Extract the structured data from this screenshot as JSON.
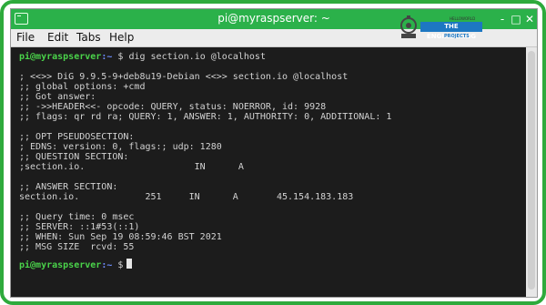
{
  "window": {
    "title": "pi@myraspserver: ~",
    "controls": {
      "minimize": "-",
      "maximize": "□",
      "close": "✕"
    }
  },
  "menu": {
    "items": [
      "File",
      "Edit",
      "Tabs",
      "Help"
    ]
  },
  "logo": {
    "tagline": "HELLOWORLD",
    "name": "THE ENGINEERING",
    "sub": "PROJECTS"
  },
  "prompt": {
    "user": "pi@myraspserver",
    "path": ":~",
    "symbol": "$"
  },
  "command": "dig section.io @localhost",
  "output": [
    "; <<>> DiG 9.9.5-9+deb8u19-Debian <<>> section.io @localhost",
    ";; global options: +cmd",
    ";; Got answer:",
    ";; ->>HEADER<<- opcode: QUERY, status: NOERROR, id: 9928",
    ";; flags: qr rd ra; QUERY: 1, ANSWER: 1, AUTHORITY: 0, ADDITIONAL: 1",
    "",
    ";; OPT PSEUDOSECTION:",
    "; EDNS: version: 0, flags:; udp: 1280",
    ";; QUESTION SECTION:",
    ";section.io.                    IN      A",
    "",
    ";; ANSWER SECTION:",
    "section.io.            251     IN      A       45.154.183.183",
    "",
    ";; Query time: 0 msec",
    ";; SERVER: ::1#53(::1)",
    ";; WHEN: Sun Sep 19 08:59:46 BST 2021",
    ";; MSG SIZE  rcvd: 55"
  ]
}
